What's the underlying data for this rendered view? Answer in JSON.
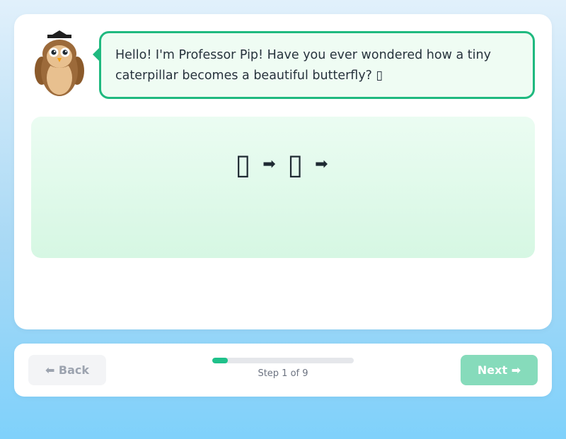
{
  "mascot": {
    "name": "Professor Pip",
    "icon": "owl-professor-icon"
  },
  "speech": {
    "text": "Hello! I'm Professor Pip! Have you ever wondered how a tiny caterpillar becomes a beautiful butterfly? ▯"
  },
  "illustration": {
    "items": [
      "▯",
      "➡",
      "▯",
      "➡"
    ]
  },
  "nav": {
    "back_label": "⬅ Back",
    "next_label": "Next ➡",
    "step_text": "Step 1 of 9",
    "progress_fraction": 0.1111
  },
  "colors": {
    "accent": "#1fb97f",
    "progress": "#1fc18a",
    "next_button": "#86dbbb"
  }
}
